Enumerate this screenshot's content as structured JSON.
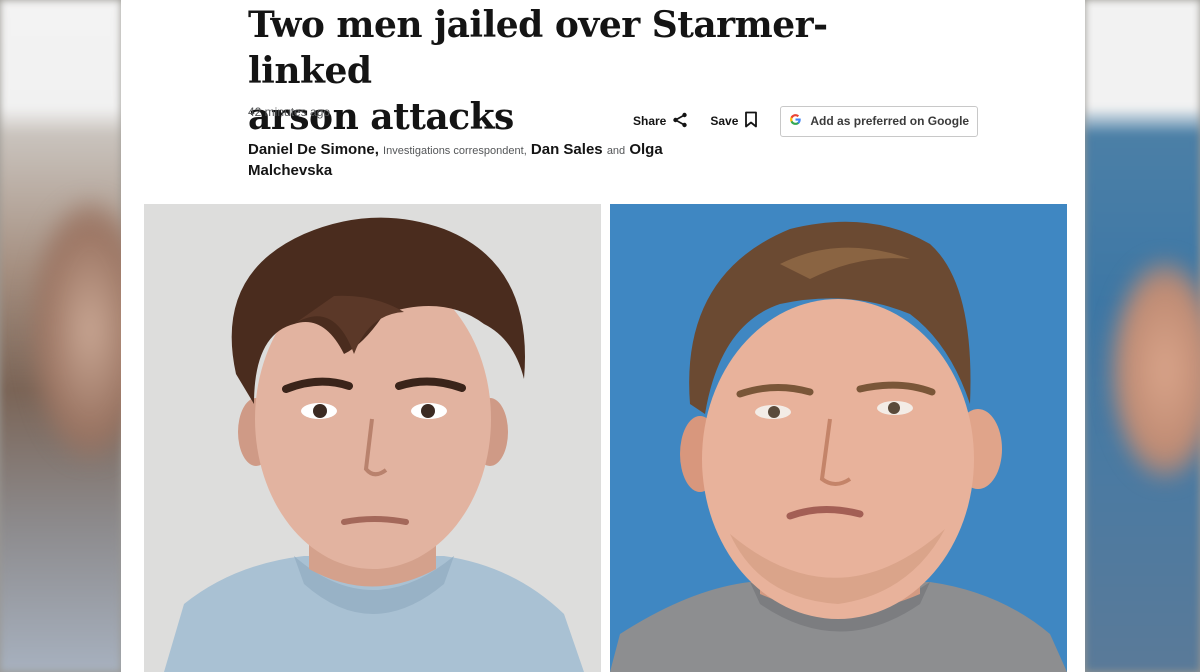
{
  "article": {
    "headline_line1": "Two men jailed over Starmer-linked",
    "headline_line2": "arson attacks",
    "timestamp": "42 minutes ago"
  },
  "actions": {
    "share_label": "Share",
    "save_label": "Save",
    "google_label": "Add as preferred on Google"
  },
  "byline": {
    "author1": "Daniel De Simone,",
    "author1_role": "Investigations correspondent,",
    "author2": "Dan Sales",
    "and": "and",
    "author3_part1": "Olga",
    "author3_part2": "Malchevska"
  },
  "icons": {
    "share": "share-icon",
    "save": "bookmark-icon",
    "google": "google-g-icon"
  },
  "colors": {
    "text": "#141414",
    "muted": "#545658",
    "right_photo_bg": "#3f86c0",
    "left_photo_bg": "#dcdcdb"
  }
}
